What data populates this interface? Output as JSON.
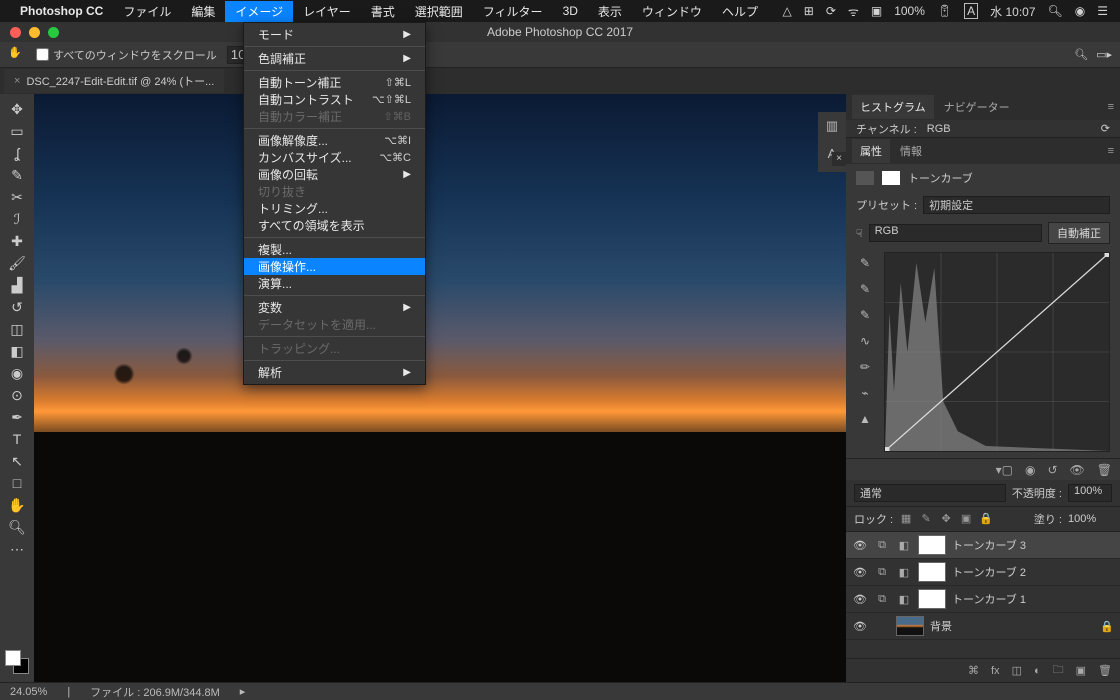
{
  "menubar": {
    "app": "Photoshop CC",
    "items": [
      "ファイル",
      "編集",
      "イメージ",
      "レイヤー",
      "書式",
      "選択範囲",
      "フィルター",
      "3D",
      "表示",
      "ウィンドウ",
      "ヘルプ"
    ],
    "active_index": 2,
    "battery": "100%",
    "clock": "水 10:07"
  },
  "window": {
    "title": "Adobe Photoshop CC 2017"
  },
  "options": {
    "scroll_all_label": "すべてのウィンドウをスクロール",
    "field1": "10"
  },
  "doc_tab": {
    "label": "DSC_2247-Edit-Edit.tif @ 24% (トー..."
  },
  "dropdown": {
    "groups": [
      [
        {
          "label": "モード",
          "arrow": true
        }
      ],
      [
        {
          "label": "色調補正",
          "arrow": true
        }
      ],
      [
        {
          "label": "自動トーン補正",
          "shortcut": "⇧⌘L"
        },
        {
          "label": "自動コントラスト",
          "shortcut": "⌥⇧⌘L"
        },
        {
          "label": "自動カラー補正",
          "shortcut": "⇧⌘B",
          "disabled": true
        }
      ],
      [
        {
          "label": "画像解像度...",
          "shortcut": "⌥⌘I"
        },
        {
          "label": "カンバスサイズ...",
          "shortcut": "⌥⌘C"
        },
        {
          "label": "画像の回転",
          "arrow": true
        },
        {
          "label": "切り抜き",
          "disabled": true
        },
        {
          "label": "トリミング..."
        },
        {
          "label": "すべての領域を表示"
        }
      ],
      [
        {
          "label": "複製..."
        },
        {
          "label": "画像操作...",
          "highlighted": true
        },
        {
          "label": "演算..."
        }
      ],
      [
        {
          "label": "変数",
          "arrow": true
        },
        {
          "label": "データセットを適用...",
          "disabled": true
        }
      ],
      [
        {
          "label": "トラッピング...",
          "disabled": true
        }
      ],
      [
        {
          "label": "解析",
          "arrow": true
        }
      ]
    ]
  },
  "panels": {
    "histogram": {
      "tab1": "ヒストグラム",
      "tab2": "ナビゲーター",
      "channel_label": "チャンネル :",
      "channel_value": "RGB"
    },
    "props": {
      "tab1": "属性",
      "tab2": "情報",
      "adj_label": "トーンカーブ",
      "preset_label": "プリセット :",
      "preset_value": "初期設定",
      "channel_value": "RGB",
      "auto_btn": "自動補正"
    },
    "layers": {
      "blend_mode": "通常",
      "opacity_label": "不透明度 :",
      "opacity_value": "100%",
      "lock_label": "ロック :",
      "fill_label": "塗り :",
      "fill_value": "100%",
      "rows": [
        {
          "name": "トーンカーブ 3",
          "type": "adj",
          "selected": true
        },
        {
          "name": "トーンカーブ 2",
          "type": "adj"
        },
        {
          "name": "トーンカーブ 1",
          "type": "adj"
        },
        {
          "name": "背景",
          "type": "bg",
          "locked": true
        }
      ]
    }
  },
  "status": {
    "zoom": "24.05%",
    "file_label": "ファイル :",
    "file_size": "206.9M/344.8M"
  }
}
